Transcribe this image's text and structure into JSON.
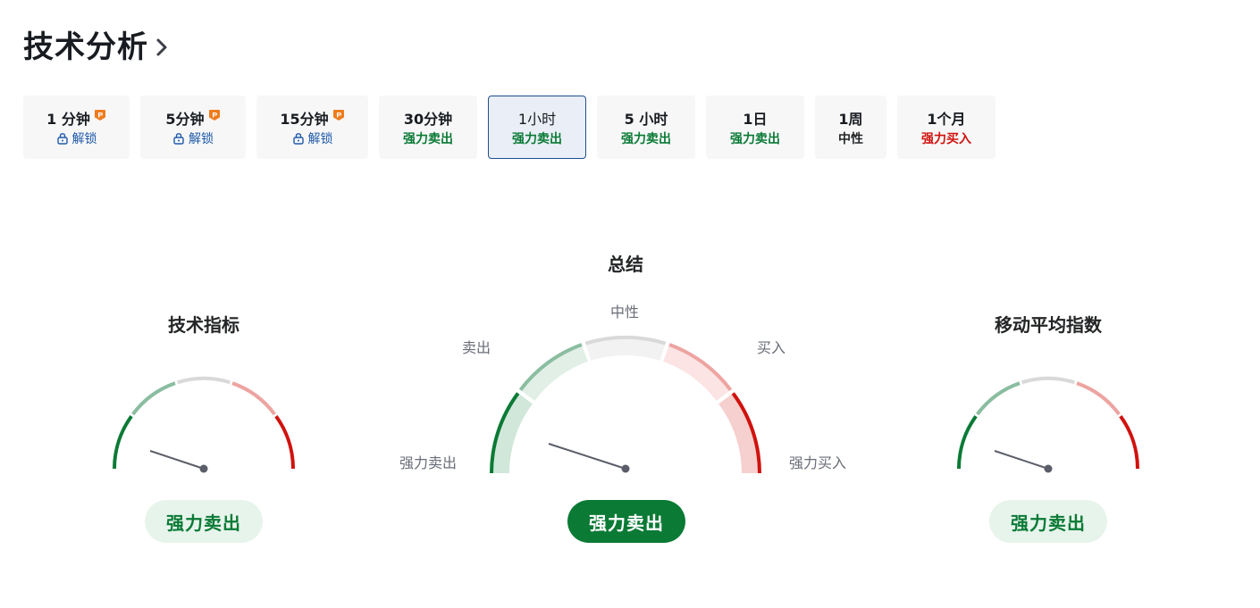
{
  "header": {
    "title": "技术分析"
  },
  "colors": {
    "strong_sell": "#0a7a35",
    "sell": "#8bbda0",
    "neutral": "#d9d9d9",
    "buy": "#eda4a1",
    "strong_buy": "#d0120e",
    "pro_badge": "#ef7c1c",
    "unlock": "#1e5aa8"
  },
  "timeframes": [
    {
      "label": "1 分钟",
      "status": "解锁",
      "locked": true,
      "pro": true,
      "tone": "unlock"
    },
    {
      "label": "5分钟",
      "status": "解锁",
      "locked": true,
      "pro": true,
      "tone": "unlock"
    },
    {
      "label": "15分钟",
      "status": "解锁",
      "locked": true,
      "pro": true,
      "tone": "unlock"
    },
    {
      "label": "30分钟",
      "status": "强力卖出",
      "locked": false,
      "pro": false,
      "tone": "sell"
    },
    {
      "label": "1小时",
      "status": "强力卖出",
      "locked": false,
      "pro": false,
      "tone": "sell",
      "active": true
    },
    {
      "label": "5 小时",
      "status": "强力卖出",
      "locked": false,
      "pro": false,
      "tone": "sell"
    },
    {
      "label": "1日",
      "status": "强力卖出",
      "locked": false,
      "pro": false,
      "tone": "sell"
    },
    {
      "label": "1周",
      "status": "中性",
      "locked": false,
      "pro": false,
      "tone": "neutral"
    },
    {
      "label": "1个月",
      "status": "强力买入",
      "locked": false,
      "pro": false,
      "tone": "buy"
    }
  ],
  "gauges": {
    "technical": {
      "title": "技术指标",
      "result": "强力卖出",
      "needle_angle_deg": 18
    },
    "summary": {
      "title": "总结",
      "result": "强力卖出",
      "needle_angle_deg": 18,
      "scale": {
        "strong_sell": "强力卖出",
        "sell": "卖出",
        "neutral": "中性",
        "buy": "买入",
        "strong_buy": "强力买入"
      }
    },
    "moving_averages": {
      "title": "移动平均指数",
      "result": "强力卖出",
      "needle_angle_deg": 18
    }
  }
}
